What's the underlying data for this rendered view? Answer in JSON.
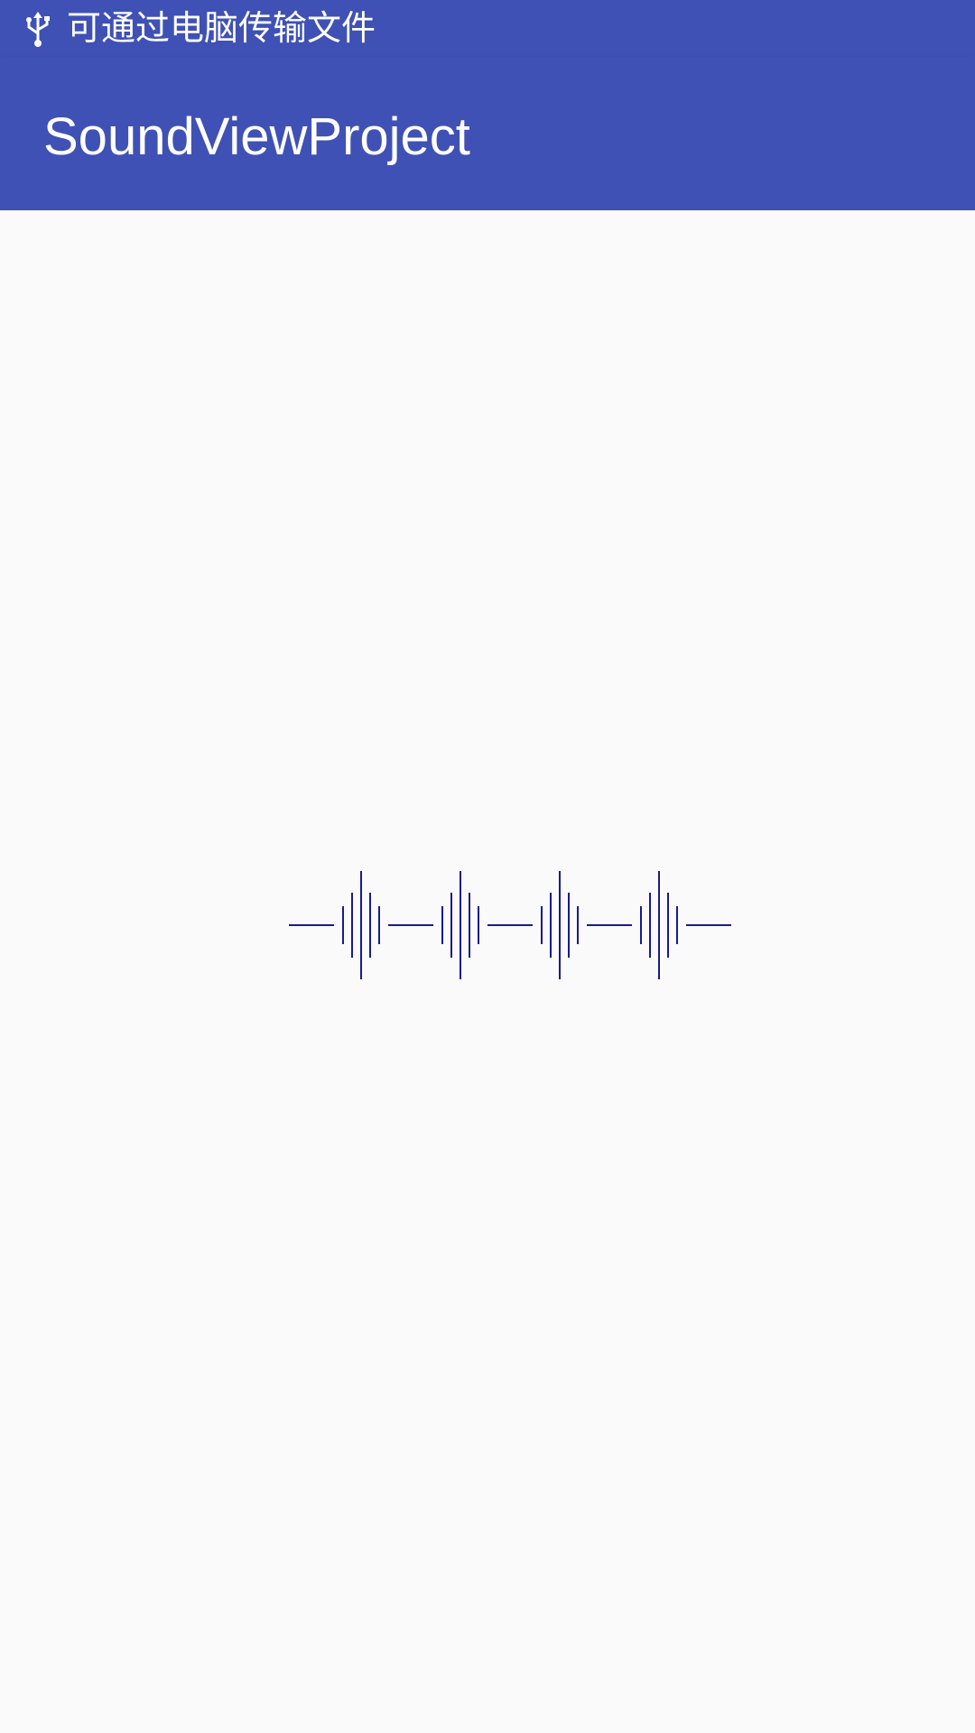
{
  "status_bar": {
    "icon": "usb-icon",
    "notification_text": "可通过电脑传输文件"
  },
  "app_bar": {
    "title": "SoundViewProject"
  },
  "sound_view": {
    "stroke_color": "#1a1a8c",
    "groups": 4,
    "group_levels": [
      0.35,
      0.6,
      1.0,
      0.6,
      0.35
    ]
  },
  "colors": {
    "primary": "#3f51b5",
    "background": "#fafafa",
    "on_primary": "#ffffff"
  }
}
